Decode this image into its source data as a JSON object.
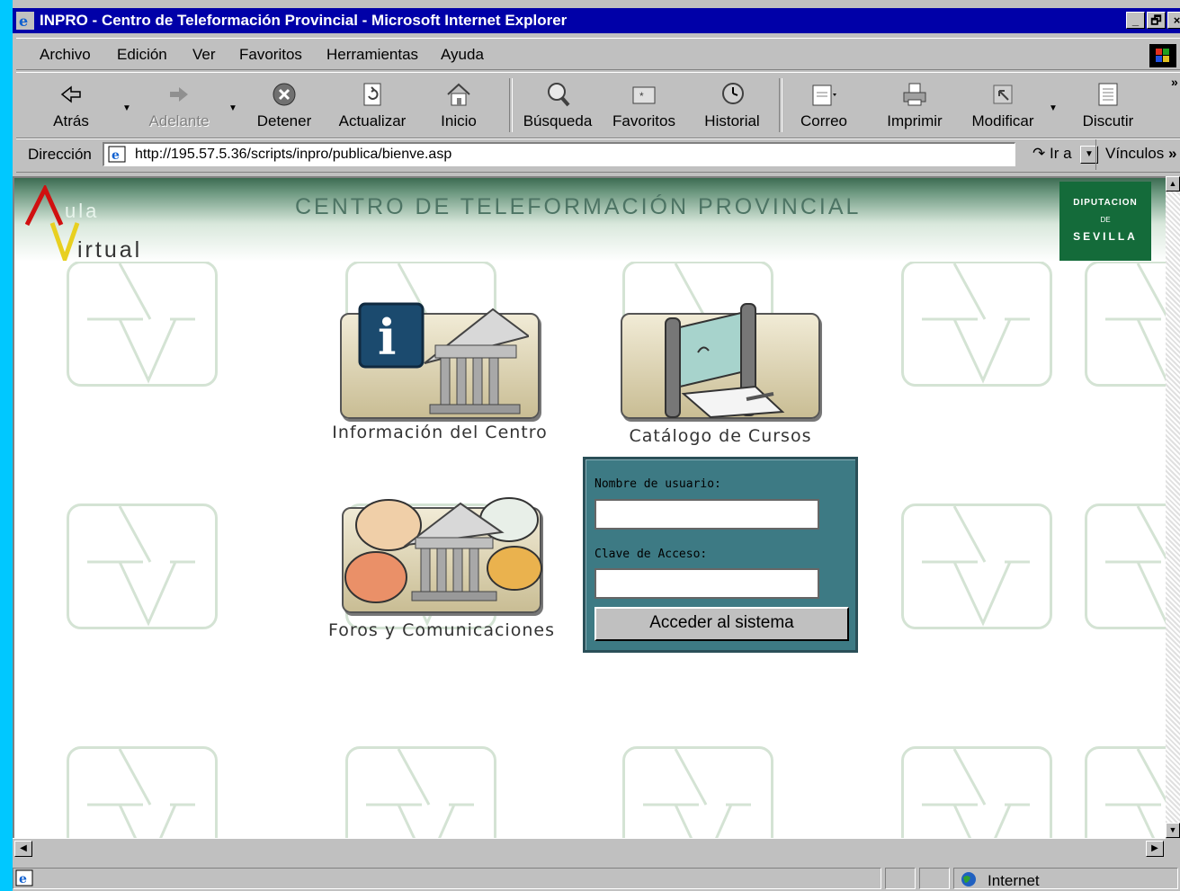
{
  "window": {
    "title": "INPRO - Centro de Teleformación Provincial - Microsoft Internet Explorer",
    "controls": [
      "_",
      "🗗",
      "×"
    ]
  },
  "menu": [
    {
      "label": "Archivo"
    },
    {
      "label": "Edición"
    },
    {
      "label": "Ver"
    },
    {
      "label": "Favoritos"
    },
    {
      "label": "Herramientas"
    },
    {
      "label": "Ayuda"
    }
  ],
  "toolbar": {
    "back": "Atrás",
    "forward": "Adelante",
    "stop": "Detener",
    "refresh": "Actualizar",
    "home": "Inicio",
    "search": "Búsqueda",
    "favorites": "Favoritos",
    "history": "Historial",
    "mail": "Correo",
    "print": "Imprimir",
    "edit": "Modificar",
    "discuss": "Discutir",
    "more": "»"
  },
  "address": {
    "label": "Dirección",
    "url": "http://195.57.5.36/scripts/inpro/publica/bienve.asp",
    "go": "Ir a",
    "links": "Vínculos",
    "links_more": "»"
  },
  "page": {
    "header_title": "CENTRO DE TELEFORMACIÓN PROVINCIAL",
    "logo": {
      "a": "A",
      "ula": "ula",
      "v": "V",
      "irtual": "irtual"
    },
    "seal": {
      "line1": "DIPUTACION",
      "line2": "DE",
      "line3": "SEVILLA"
    },
    "cards": {
      "info": "Información del Centro",
      "catalog": "Catálogo de Cursos",
      "forums": "Foros y Comunicaciones"
    },
    "login": {
      "user_label": "Nombre de usuario:",
      "user_value": "",
      "pass_label": "Clave de Acceso:",
      "pass_value": "",
      "submit": "Acceder al sistema"
    }
  },
  "statusbar": {
    "zone": "Internet"
  }
}
